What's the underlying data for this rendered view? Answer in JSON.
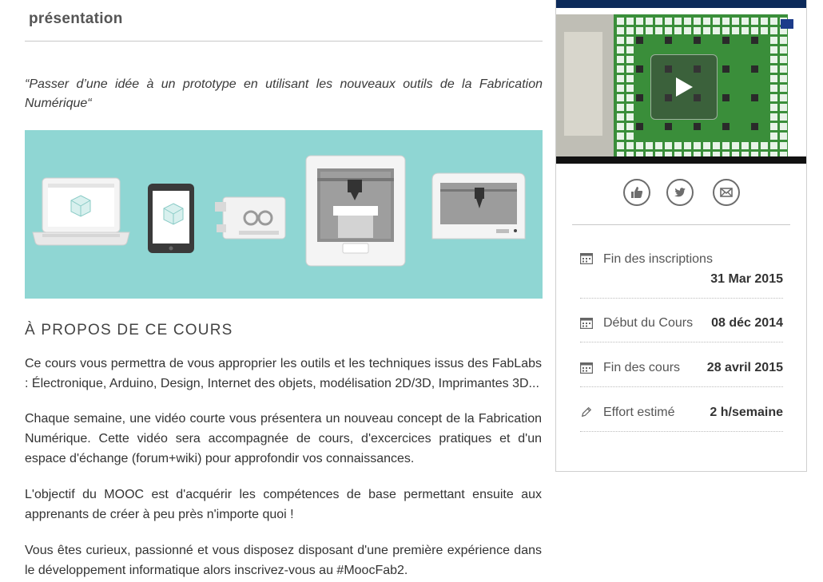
{
  "main": {
    "section_title": "présentation",
    "quote": "“Passer d’une idée à un prototype en utilisant les nouveaux outils de la Fabrication Numérique“",
    "about_title": "À PROPOS DE CE COURS",
    "paragraphs": [
      "Ce cours vous permettra de vous approprier les outils et les techniques issus des FabLabs : Électronique, Arduino, Design, Internet des objets, modélisation 2D/3D, Imprimantes 3D...",
      "Chaque semaine, une vidéo courte vous présentera un nouveau concept de la Fabrication Numérique. Cette vidéo sera accompagnée de cours, d'excercices pratiques et d'un espace d'échange (forum+wiki) pour approfondir vos connaissances.",
      "L'objectif du MOOC est d'acquérir les compétences de base permettant ensuite aux apprenants de créer à peu près n'importe quoi !",
      "Vous êtes curieux, passionné et vous disposez disposant d'une première expérience dans le développement informatique alors inscrivez-vous au #MoocFab2."
    ],
    "hero_color": "#8fd6d3"
  },
  "sidebar": {
    "share_icons": [
      "thumbs-up-icon",
      "twitter-icon",
      "email-icon"
    ],
    "info": [
      {
        "icon": "calendar-icon",
        "label": "Fin des inscriptions",
        "value": "31 Mar 2015"
      },
      {
        "icon": "calendar-icon",
        "label": "Début du Cours",
        "value": "08 déc 2014"
      },
      {
        "icon": "calendar-icon",
        "label": "Fin des cours",
        "value": "28 avril 2015"
      },
      {
        "icon": "pencil-icon",
        "label": "Effort estimé",
        "value": "2 h/semaine"
      }
    ]
  }
}
